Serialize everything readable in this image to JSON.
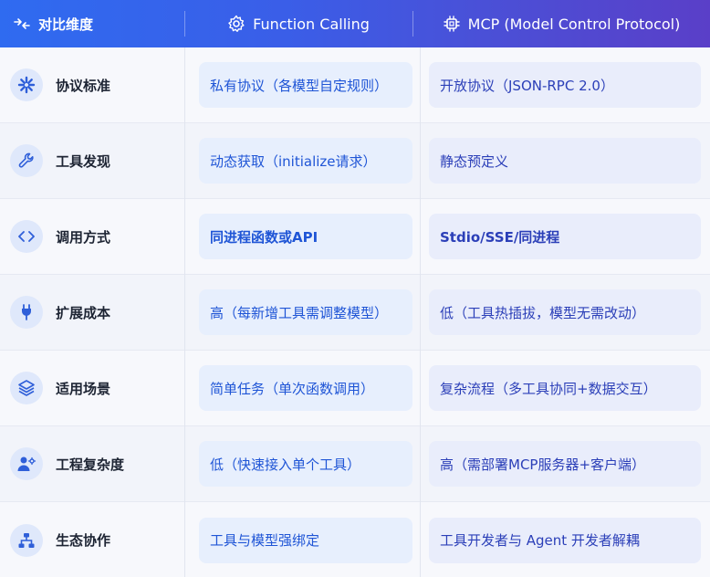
{
  "header": {
    "col_dimension": "对比维度",
    "col_function_calling": "Function Calling",
    "col_mcp": "MCP (Model Control Protocol)"
  },
  "rows": [
    {
      "dimension": "协议标准",
      "icon": "asterisk-icon",
      "fc": "私有协议（各模型自定规则）",
      "mcp": "开放协议（JSON-RPC 2.0）"
    },
    {
      "dimension": "工具发现",
      "icon": "wrench-icon",
      "fc": "动态获取（initialize请求）",
      "mcp": "静态预定义"
    },
    {
      "dimension": "调用方式",
      "icon": "code-icon",
      "fc": "同进程函数或API",
      "mcp": "Stdio/SSE/同进程"
    },
    {
      "dimension": "扩展成本",
      "icon": "plug-icon",
      "fc": "高（每新增工具需调整模型）",
      "mcp": "低（工具热插拔，模型无需改动）"
    },
    {
      "dimension": "适用场景",
      "icon": "layers-icon",
      "fc": "简单任务（单次函数调用）",
      "mcp": "复杂流程（多工具协同+数据交互）"
    },
    {
      "dimension": "工程复杂度",
      "icon": "user-gear-icon",
      "fc": "低（快速接入单个工具）",
      "mcp": "高（需部署MCP服务器+客户端）"
    },
    {
      "dimension": "生态协作",
      "icon": "sitemap-icon",
      "fc": "工具与模型强绑定",
      "mcp": "工具开发者与 Agent 开发者解耦"
    }
  ],
  "colors": {
    "header_start": "#2f6bf0",
    "header_end": "#5a3fc8",
    "fc_cell_bg": "#e7effd",
    "mcp_cell_bg": "#e9edfb",
    "accent_text": "#1f55d6"
  }
}
